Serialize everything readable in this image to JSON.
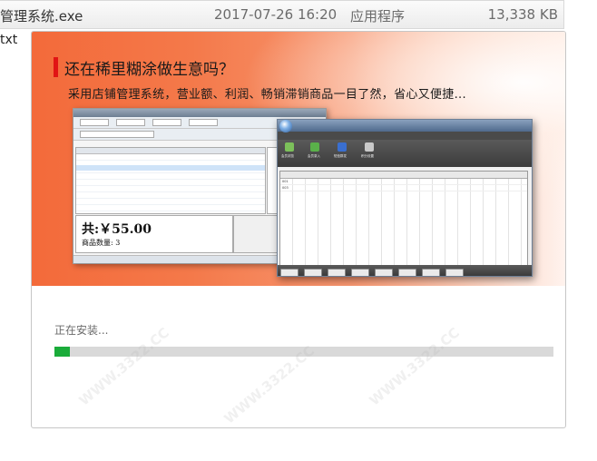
{
  "file_row": {
    "name": "管理系统.exe",
    "date": "2017-07-26 16:20",
    "type": "应用程序",
    "size": "13,338 KB"
  },
  "side_text": "txt",
  "banner": {
    "headline": "还在稀里糊涂做生意吗？",
    "subline": "采用店铺管理系统，营业额、利润、畅销滞销商品一目了然，省心又便捷...",
    "shot1": {
      "total": "共:￥55.00",
      "qty": "商品数量: 3",
      "amount": "50.00"
    },
    "shot2": {
      "tabs": [
        "会员管理",
        "消费项目",
        "统计查询",
        "系统设置"
      ],
      "ribbon": [
        "会员浏览",
        "会员录入",
        "短信群发",
        "积分设置"
      ],
      "rows": [
        "001",
        "003"
      ],
      "buttons": [
        "刷新",
        "充值",
        "消费记录",
        "导出Excel",
        "搜索"
      ]
    }
  },
  "install": {
    "status": "正在安装...",
    "progress": 0.03
  },
  "watermark": "WWW.3322.CC",
  "colors": {
    "progress": "#1aac3a",
    "accent": "#e11414"
  }
}
